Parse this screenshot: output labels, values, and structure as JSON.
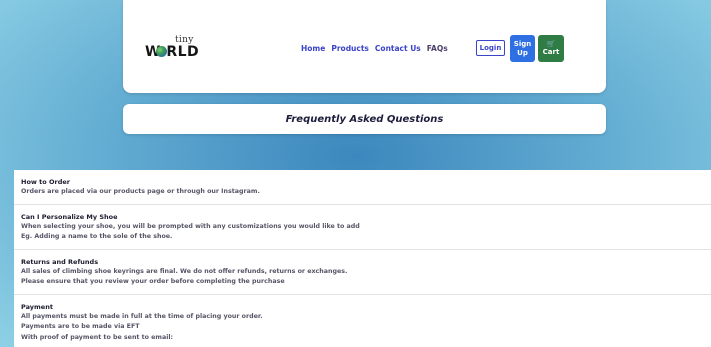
{
  "header": {
    "logo_small": "tiny",
    "logo_big": "W RLD",
    "nav": [
      "Home",
      "Products",
      "Contact Us",
      "FAQs"
    ],
    "login_label": "Login",
    "signup_label": "Sign Up",
    "cart_label": "Cart",
    "cart_icon": "cart-icon",
    "colors": {
      "signup": "#2f6fe4",
      "cart": "#2f7d45",
      "nav": "#3b43c8"
    }
  },
  "page_title": "Frequently Asked Questions",
  "faq": [
    {
      "question": "How to Order",
      "answer_lines": [
        "Orders are placed via our products page or through our Instagram."
      ]
    },
    {
      "question": "Can I Personalize My Shoe",
      "answer_lines": [
        "When selecting your shoe, you will be prompted with any customizations you would like to add",
        "Eg. Adding a name to the sole of the shoe."
      ]
    },
    {
      "question": "Returns and Refunds",
      "answer_lines": [
        "All sales of climbing shoe keyrings are final. We do not offer refunds, returns or exchanges.",
        "Please ensure that you review your order before completing the purchase"
      ]
    },
    {
      "question": "Payment",
      "answer_lines": [
        "All payments must be made in full at the time of placing your order.",
        "Payments are to be made via EFT",
        "With proof of payment to be sent to email:"
      ]
    }
  ]
}
